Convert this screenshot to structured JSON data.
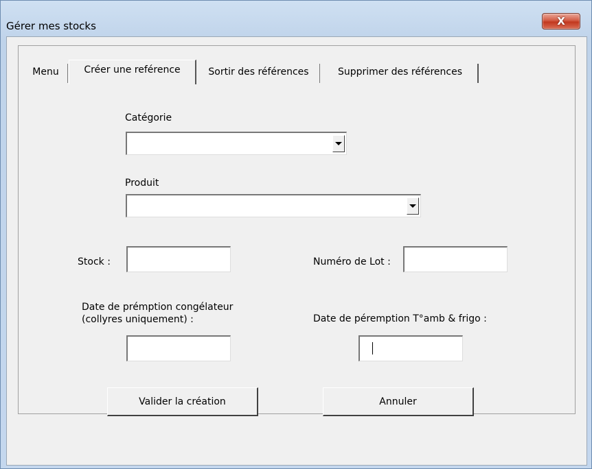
{
  "window": {
    "title": "Gérer mes stocks",
    "close_label": "X"
  },
  "tabs": [
    {
      "label": "Menu",
      "active": false
    },
    {
      "label": "Créer une reférence",
      "active": true
    },
    {
      "label": "Sortir des références",
      "active": false
    },
    {
      "label": "Supprimer des références",
      "active": false
    }
  ],
  "form": {
    "categorie_label": "Catégorie",
    "categorie_value": "",
    "produit_label": "Produit",
    "produit_value": "",
    "stock_label": "Stock :",
    "stock_value": "",
    "lot_label": "Numéro de Lot :",
    "lot_value": "",
    "date_congel_label_line1": "Date de prémption congélateur",
    "date_congel_label_line2": "(collyres uniquement) :",
    "date_congel_value": "",
    "date_amb_label": "Date de péremption T°amb & frigo :",
    "date_amb_value": ""
  },
  "buttons": {
    "validate_label": "Valider la création",
    "cancel_label": "Annuler"
  }
}
